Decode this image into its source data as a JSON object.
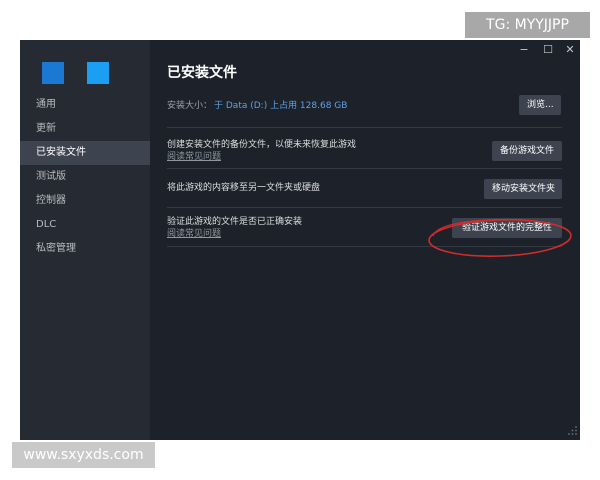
{
  "watermarks": {
    "top": "TG: MYYJJPP",
    "bottom": "www.sxyxds.com"
  },
  "window": {
    "controls": {
      "minimize": "−",
      "maximize": "☐",
      "close": "✕"
    }
  },
  "sidebar": {
    "items": [
      {
        "label": "通用",
        "active": false
      },
      {
        "label": "更新",
        "active": false
      },
      {
        "label": "已安装文件",
        "active": true
      },
      {
        "label": "测试版",
        "active": false
      },
      {
        "label": "控制器",
        "active": false
      },
      {
        "label": "DLC",
        "active": false
      },
      {
        "label": "私密管理",
        "active": false
      }
    ]
  },
  "main": {
    "title": "已安装文件",
    "install_size_label": "安装大小：",
    "install_size_value": "于 Data (D:) 上占用 128.68 GB",
    "browse_button": "浏览...",
    "backup": {
      "text": "创建安装文件的备份文件，以便未来恢复此游戏",
      "link": "阅读常见问题",
      "button": "备份游戏文件"
    },
    "move": {
      "text": "将此游戏的内容移至另一文件夹或硬盘",
      "button": "移动安装文件夹"
    },
    "verify": {
      "text": "验证此游戏的文件是否已正确安装",
      "link": "阅读常见问题",
      "button": "验证游戏文件的完整性"
    }
  },
  "colors": {
    "accent": "#5ea2e6",
    "annotation": "#d12b2b"
  }
}
